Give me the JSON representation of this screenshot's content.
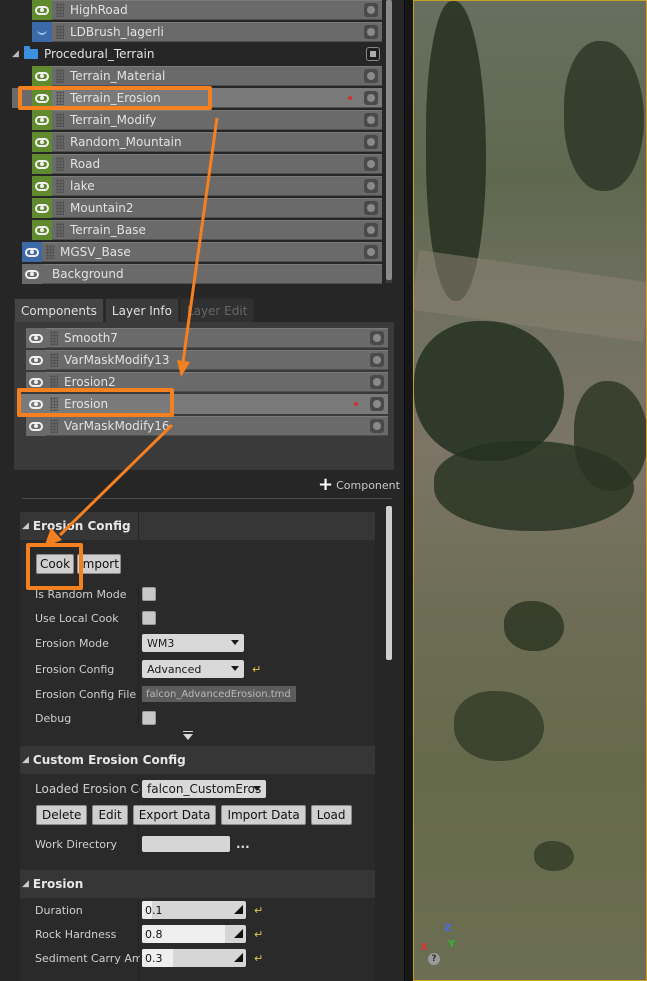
{
  "layers": {
    "items": [
      {
        "label": "HighRoad",
        "eye": "green"
      },
      {
        "label": "LDBrush_lagerli",
        "eye": "blue-shape"
      }
    ],
    "folder": {
      "label": "Procedural_Terrain"
    },
    "folder_items": [
      {
        "label": "Terrain_Material"
      },
      {
        "label": "Terrain_Erosion",
        "selected": true
      },
      {
        "label": "Terrain_Modify"
      },
      {
        "label": "Random_Mountain"
      },
      {
        "label": "Road"
      },
      {
        "label": "lake"
      },
      {
        "label": "Mountain2"
      },
      {
        "label": "Terrain_Base"
      }
    ],
    "root_items": [
      {
        "label": "MGSV_Base"
      },
      {
        "label": "Background"
      }
    ]
  },
  "tabs": [
    {
      "label": "Components",
      "state": "active"
    },
    {
      "label": "Layer Info",
      "state": "normal"
    },
    {
      "label": "Layer Edit",
      "state": "disabled"
    }
  ],
  "components": {
    "items": [
      {
        "label": "Smooth7"
      },
      {
        "label": "VarMaskModify13"
      },
      {
        "label": "Erosion2"
      },
      {
        "label": "Erosion",
        "selected": true
      },
      {
        "label": "VarMaskModify16"
      }
    ],
    "add_label": "Component"
  },
  "erosion_config": {
    "header": "Erosion Config",
    "cook_label": "Cook",
    "import_label": "Import",
    "rows": {
      "random_mode": "Is Random Mode",
      "local_cook": "Use Local Cook",
      "erosion_mode": "Erosion Mode",
      "erosion_mode_value": "WM3",
      "config": "Erosion Config",
      "config_value": "Advanced",
      "config_file": "Erosion Config File",
      "config_file_value": "falcon_AdvancedErosion.tmd",
      "debug": "Debug"
    }
  },
  "custom_config": {
    "header": "Custom Erosion Config",
    "loaded_label": "Loaded Erosion Cc",
    "loaded_value": "falcon_CustomEros",
    "buttons": [
      "Delete",
      "Edit",
      "Export Data",
      "Import Data",
      "Load"
    ],
    "work_dir": "Work Directory",
    "dots": "..."
  },
  "erosion": {
    "header": "Erosion",
    "params": [
      {
        "label": "Duration",
        "value": "0.1",
        "fraction": 0.1
      },
      {
        "label": "Rock Hardness",
        "value": "0.8",
        "fraction": 0.8
      },
      {
        "label": "Sediment Carry Amo",
        "value": "0.3",
        "fraction": 0.3
      }
    ]
  },
  "viewport": {
    "gizmo_z": "Z",
    "gizmo_x": "X",
    "gizmo_y": "Y",
    "help": "?"
  },
  "colors": {
    "annotation": "#f58020",
    "eye_green": "#5f8a2e",
    "eye_blue": "#3c6aa8"
  }
}
